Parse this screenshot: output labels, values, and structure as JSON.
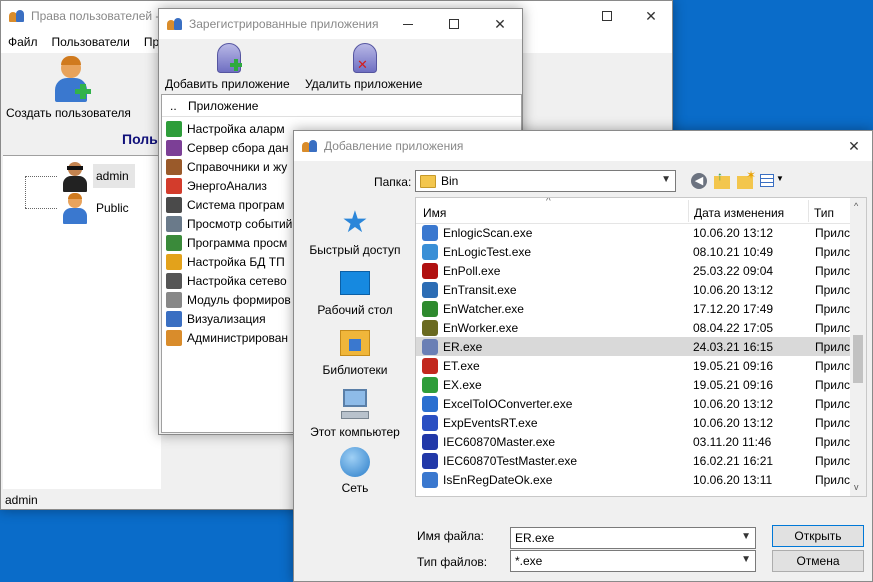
{
  "users_window": {
    "title": "Права пользователей - ",
    "menu": [
      "Файл",
      "Пользователи",
      "Пр"
    ],
    "create_user_label": "Создать пользователя",
    "section_heading": "Польз",
    "users": [
      "admin",
      "Public"
    ],
    "status_text": "admin"
  },
  "apps_window": {
    "title": "Зарегистрированные приложения",
    "add_label": "Добавить приложение",
    "remove_label": "Удалить приложение",
    "col_dots": "..",
    "col_app": "Приложение",
    "apps": [
      "Настройка аларм",
      "Сервер сбора дан",
      "Справочники и жу",
      "ЭнергоАнализ",
      "Система програм",
      "Просмотр событий",
      "Программа просм",
      "Настройка БД ТП",
      "Настройка сетево",
      "Модуль формиров",
      "Визуализация",
      "Администрирован"
    ]
  },
  "file_dialog": {
    "title": "Добавление приложения",
    "folder_label": "Папка:",
    "folder_value": "Bin",
    "places": [
      "Быстрый доступ",
      "Рабочий стол",
      "Библиотеки",
      "Этот компьютер",
      "Сеть"
    ],
    "col_name": "Имя",
    "col_date": "Дата изменения",
    "col_type": "Тип",
    "files": [
      {
        "name": "EnlogicScan.exe",
        "date": "10.06.20 13:12",
        "type": "Прилс"
      },
      {
        "name": "EnLogicTest.exe",
        "date": "08.10.21 10:49",
        "type": "Прилс"
      },
      {
        "name": "EnPoll.exe",
        "date": "25.03.22 09:04",
        "type": "Прилс"
      },
      {
        "name": "EnTransit.exe",
        "date": "10.06.20 13:12",
        "type": "Прилс"
      },
      {
        "name": "EnWatcher.exe",
        "date": "17.12.20 17:49",
        "type": "Прилс"
      },
      {
        "name": "EnWorker.exe",
        "date": "08.04.22 17:05",
        "type": "Прилс"
      },
      {
        "name": "ER.exe",
        "date": "24.03.21 16:15",
        "type": "Прилс"
      },
      {
        "name": "ET.exe",
        "date": "19.05.21 09:16",
        "type": "Прилс"
      },
      {
        "name": "EX.exe",
        "date": "19.05.21 09:16",
        "type": "Прилс"
      },
      {
        "name": "ExcelToIOConverter.exe",
        "date": "10.06.20 13:12",
        "type": "Прилс"
      },
      {
        "name": "ExpEventsRT.exe",
        "date": "10.06.20 13:12",
        "type": "Прилс"
      },
      {
        "name": "IEC60870Master.exe",
        "date": "03.11.20 11:46",
        "type": "Прилс"
      },
      {
        "name": "IEC60870TestMaster.exe",
        "date": "16.02.21 16:21",
        "type": "Прилс"
      },
      {
        "name": "IsEnRegDateOk.exe",
        "date": "10.06.20 13:11",
        "type": "Прилс"
      }
    ],
    "filename_label": "Имя файла:",
    "filename_value": "ER.exe",
    "filetype_label": "Тип файлов:",
    "filetype_value": "*.exe",
    "open_label": "Открыть",
    "cancel_label": "Отмена"
  }
}
